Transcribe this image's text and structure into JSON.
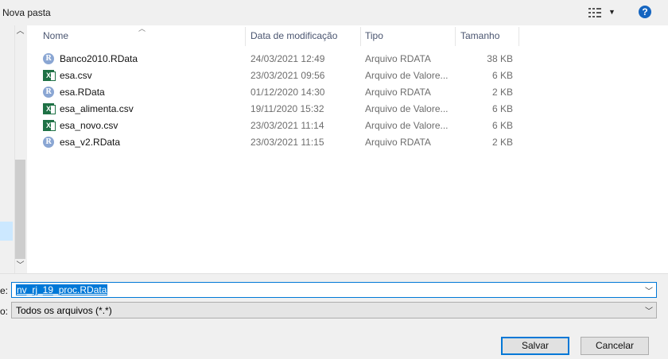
{
  "toolbar": {
    "new_folder_label": "Nova pasta",
    "help_label": "?",
    "view_icon": "view-options-icon"
  },
  "columns": {
    "name": "Nome",
    "modified": "Data de modificação",
    "type": "Tipo",
    "size": "Tamanho"
  },
  "files": [
    {
      "icon": "r",
      "icon_text": "R",
      "name": "Banco2010.RData",
      "modified": "24/03/2021 12:49",
      "type": "Arquivo RDATA",
      "size": "38 KB"
    },
    {
      "icon": "x",
      "icon_text": "X",
      "name": "esa.csv",
      "modified": "23/03/2021 09:56",
      "type": "Arquivo de Valore...",
      "size": "6 KB"
    },
    {
      "icon": "r",
      "icon_text": "R",
      "name": "esa.RData",
      "modified": "01/12/2020 14:30",
      "type": "Arquivo RDATA",
      "size": "2 KB"
    },
    {
      "icon": "x",
      "icon_text": "X",
      "name": "esa_alimenta.csv",
      "modified": "19/11/2020 15:32",
      "type": "Arquivo de Valore...",
      "size": "6 KB"
    },
    {
      "icon": "x",
      "icon_text": "X",
      "name": "esa_novo.csv",
      "modified": "23/03/2021 11:14",
      "type": "Arquivo de Valore...",
      "size": "6 KB"
    },
    {
      "icon": "r",
      "icon_text": "R",
      "name": "esa_v2.RData",
      "modified": "23/03/2021 11:15",
      "type": "Arquivo RDATA",
      "size": "2 KB"
    }
  ],
  "form": {
    "filename_label": "e:",
    "filename_value": "nv_rj_19_proc.RData",
    "filetype_label": "o:",
    "filetype_value": "Todos os arquivos (*.*)"
  },
  "buttons": {
    "save": "Salvar",
    "cancel": "Cancelar"
  },
  "colors": {
    "accent": "#0078d7",
    "excel": "#1e7145",
    "r_icon": "#8aa6d3",
    "help": "#1565c0"
  }
}
